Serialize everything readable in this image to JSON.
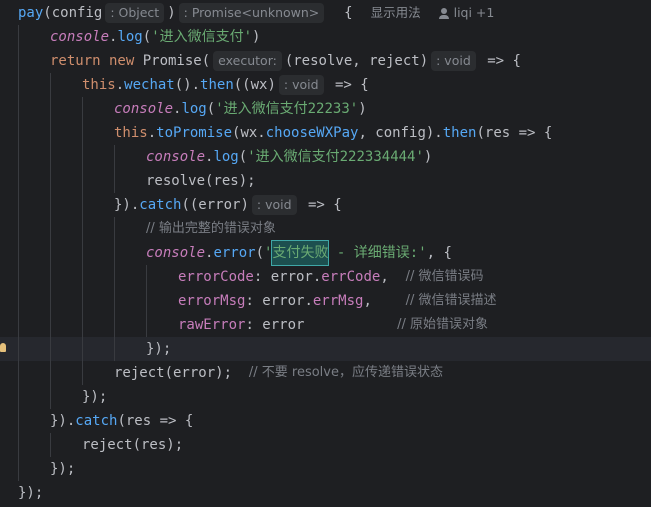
{
  "editor": {
    "lines": [
      [
        [
          "fn",
          "pay"
        ],
        [
          "pln",
          "(config"
        ],
        [
          "hint",
          ": Object"
        ],
        [
          "pln",
          ")"
        ],
        [
          "hint",
          ": Promise<unknown>"
        ],
        [
          "pln",
          "  {"
        ],
        [
          "lens",
          "显示用法"
        ],
        [
          "author",
          "liqi +1"
        ]
      ],
      [
        [
          "cn",
          "console"
        ],
        [
          "pln",
          "."
        ],
        [
          "fn",
          "log"
        ],
        [
          "pln",
          "("
        ],
        [
          "str",
          "'进入微信支付'"
        ],
        [
          "pln",
          ")"
        ]
      ],
      [
        [
          "kw",
          "return new "
        ],
        [
          "cls",
          "Promise"
        ],
        [
          "pln",
          "("
        ],
        [
          "hint",
          "executor:"
        ],
        [
          "pln",
          "(resolve, reject)"
        ],
        [
          "hint",
          ": void"
        ],
        [
          "pln",
          " => {"
        ]
      ],
      [
        [
          "kw",
          "this"
        ],
        [
          "pln",
          "."
        ],
        [
          "fn",
          "wechat"
        ],
        [
          "pln",
          "()."
        ],
        [
          "fn",
          "then"
        ],
        [
          "pln",
          "((wx)"
        ],
        [
          "hint",
          ": void"
        ],
        [
          "pln",
          " => {"
        ]
      ],
      [
        [
          "cn",
          "console"
        ],
        [
          "pln",
          "."
        ],
        [
          "fn",
          "log"
        ],
        [
          "pln",
          "("
        ],
        [
          "str",
          "'进入微信支付22233'"
        ],
        [
          "pln",
          ")"
        ]
      ],
      [
        [
          "kw",
          "this"
        ],
        [
          "pln",
          "."
        ],
        [
          "fn",
          "toPromise"
        ],
        [
          "pln",
          "(wx."
        ],
        [
          "fn",
          "chooseWXPay"
        ],
        [
          "pln",
          ", config)."
        ],
        [
          "fn",
          "then"
        ],
        [
          "pln",
          "(res => {"
        ]
      ],
      [
        [
          "cn",
          "console"
        ],
        [
          "pln",
          "."
        ],
        [
          "fn",
          "log"
        ],
        [
          "pln",
          "("
        ],
        [
          "str",
          "'进入微信支付222334444'"
        ],
        [
          "pln",
          ")"
        ]
      ],
      [
        [
          "pln",
          "resolve(res);"
        ]
      ],
      [
        [
          "pln",
          "})."
        ],
        [
          "fn",
          "catch"
        ],
        [
          "pln",
          "((error)"
        ],
        [
          "hint",
          ": void"
        ],
        [
          "pln",
          " => {"
        ]
      ],
      [
        [
          "cmt",
          "// 输出完整的错误对象"
        ]
      ],
      [
        [
          "cn",
          "console"
        ],
        [
          "pln",
          "."
        ],
        [
          "fn",
          "error"
        ],
        [
          "pln",
          "("
        ],
        [
          "str",
          "'"
        ],
        [
          "sel",
          "支付失败"
        ],
        [
          "str",
          " - 详细错误:'"
        ],
        [
          "pln",
          ", {"
        ]
      ],
      [
        [
          "prop",
          "errorCode"
        ],
        [
          "pln",
          ": error."
        ],
        [
          "prop",
          "errCode"
        ],
        [
          "pln",
          ",  "
        ],
        [
          "cmt",
          "// 微信错误码"
        ]
      ],
      [
        [
          "prop",
          "errorMsg"
        ],
        [
          "pln",
          ": error."
        ],
        [
          "prop",
          "errMsg"
        ],
        [
          "pln",
          ",    "
        ],
        [
          "cmt",
          "// 微信错误描述"
        ]
      ],
      [
        [
          "prop",
          "rawError"
        ],
        [
          "pln",
          ": error           "
        ],
        [
          "cmt",
          "// 原始错误对象"
        ]
      ],
      [
        [
          "pln",
          "});"
        ]
      ],
      [
        [
          "pln",
          "reject(error);  "
        ],
        [
          "cmt",
          "// 不要 resolve，应传递错误状态"
        ]
      ],
      [
        [
          "pln",
          "});"
        ]
      ],
      [
        [
          "pln",
          "})."
        ],
        [
          "fn",
          "catch"
        ],
        [
          "pln",
          "(res => {"
        ]
      ],
      [
        [
          "pln",
          "reject(res);"
        ]
      ],
      [
        [
          "pln",
          "});"
        ]
      ],
      [
        [
          "pln",
          "});"
        ]
      ]
    ]
  }
}
